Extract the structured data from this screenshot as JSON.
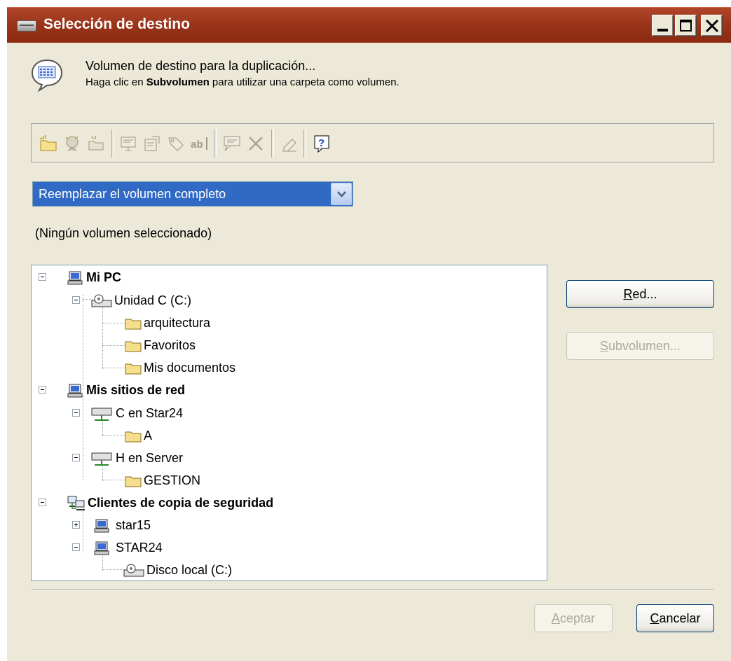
{
  "window": {
    "title": "Selección de destino"
  },
  "info": {
    "line1": "Volumen de destino para la duplicación...",
    "line2_prefix": "Haga clic en ",
    "line2_bold": "Subvolumen",
    "line2_suffix": " para utilizar una carpeta como volumen."
  },
  "toolbar": {
    "icons": [
      "new-folder-icon",
      "wizard-icon",
      "folder-network-icon",
      "presentation-icon",
      "properties-icon",
      "tag-icon",
      "rename-icon",
      "comment-icon",
      "delete-icon",
      "erase-icon",
      "help-icon"
    ]
  },
  "mode_select": {
    "selected": "Reemplazar el volumen completo"
  },
  "status": "(Ningún volumen seleccionado)",
  "tree": {
    "nodes": [
      {
        "label": "Mi PC",
        "bold": true
      },
      {
        "label": "Unidad C (C:)",
        "bold": false
      },
      {
        "label": "arquitectura",
        "bold": false
      },
      {
        "label": "Favoritos",
        "bold": false
      },
      {
        "label": "Mis documentos",
        "bold": false
      },
      {
        "label": "Mis sitios de red",
        "bold": true
      },
      {
        "label": "C en Star24",
        "bold": false
      },
      {
        "label": "A",
        "bold": false
      },
      {
        "label": "H en Server",
        "bold": false
      },
      {
        "label": "GESTION",
        "bold": false
      },
      {
        "label": "Clientes de copia de seguridad",
        "bold": true
      },
      {
        "label": "star15",
        "bold": false
      },
      {
        "label": "STAR24",
        "bold": false
      },
      {
        "label": "Disco local (C:)",
        "bold": false
      }
    ]
  },
  "buttons": {
    "network": {
      "mnemonic": "R",
      "rest": "ed..."
    },
    "subvolume": {
      "mnemonic": "S",
      "rest": "ubvolumen..."
    },
    "accept": {
      "mnemonic": "A",
      "rest": "ceptar"
    },
    "cancel": {
      "mnemonic": "C",
      "rest": "ancelar"
    }
  },
  "colors": {
    "titlebar": "#9a3418",
    "selection": "#316ac5",
    "dialog_bg": "#ece9d8"
  }
}
